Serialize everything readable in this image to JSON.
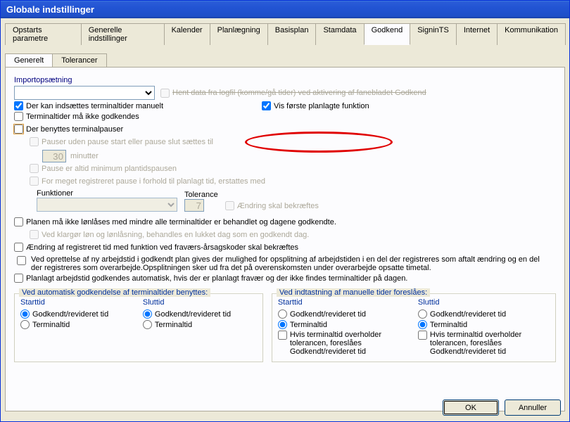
{
  "window": {
    "title": "Globale indstillinger"
  },
  "tabs": {
    "t0": "Opstarts parametre",
    "t1": "Generelle indstillinger",
    "t2": "Kalender",
    "t3": "Planlægning",
    "t4": "Basisplan",
    "t5": "Stamdata",
    "t6": "Godkend",
    "t7": "SigninTS",
    "t8": "Internet",
    "t9": "Kommunikation"
  },
  "subtabs": {
    "s0": "Generelt",
    "s1": "Tolerancer"
  },
  "import": {
    "heading": "Importopsætning",
    "logfil": "Hent data fra logfil (komme/gå tider) ved aktivering af fanebladet Godkend",
    "manuelt": "Der kan indsættes terminaltider manuelt",
    "visforste": "Vis første planlagte funktion",
    "ikkegodk": "Terminaltider må ikke godkendes",
    "termpauser": "Der benyttes terminalpauser",
    "pauser_uden": "Pauser uden pause start eller pause slut sættes til",
    "pauser_min_value": "30",
    "pauser_min_label": "minutter",
    "pause_altid": "Pause er altid minimum plantidspausen",
    "formeget": "For meget registreret pause i forhold til planlagt tid, erstattes med",
    "funktioner": "Funktioner",
    "tolerance": "Tolerance",
    "tol_value": "7",
    "aendring_bekraeft": "Ændring skal bekræftes"
  },
  "middle": {
    "planen": "Planen må ikke lønlåses med mindre alle terminaltider er behandlet og dagene godkendte.",
    "vedklargor": "Ved klargør løn og lønlåsning, behandles en lukket dag som en godkendt dag.",
    "aendring_fravaer": "Ændring af registreret tid med funktion ved fraværs-årsagskoder skal bekræftes",
    "vedoprettelse": "Ved oprettelse af ny arbejdstid i godkendt plan gives der mulighed for opsplitning af arbejdstiden i en del der registreres som aftalt ændring og en del der registreres som overarbejde.Opsplitningen sker ud fra det på overenskomsten under overarbejde opsatte timetal.",
    "planlagt": "Planlagt arbejdstid godkendes automatisk, hvis der er planlagt fravær og der ikke findes terminaltider på dagen."
  },
  "auto": {
    "legend": "Ved automatisk godkendelse af terminaltider benyttes:",
    "starttid": "Starttid",
    "sluttid": "Sluttid",
    "godkrev": "Godkendt/revideret tid",
    "terminal": "Terminaltid"
  },
  "manual": {
    "legend": "Ved indtastning af manuelle tider foreslåes:",
    "starttid": "Starttid",
    "sluttid": "Sluttid",
    "godkrev": "Godkendt/revideret tid",
    "terminal": "Terminaltid",
    "hvis": "Hvis terminaltid overholder tolerancen, foreslåes Godkendt/revideret tid"
  },
  "buttons": {
    "ok": "OK",
    "cancel": "Annuller"
  }
}
